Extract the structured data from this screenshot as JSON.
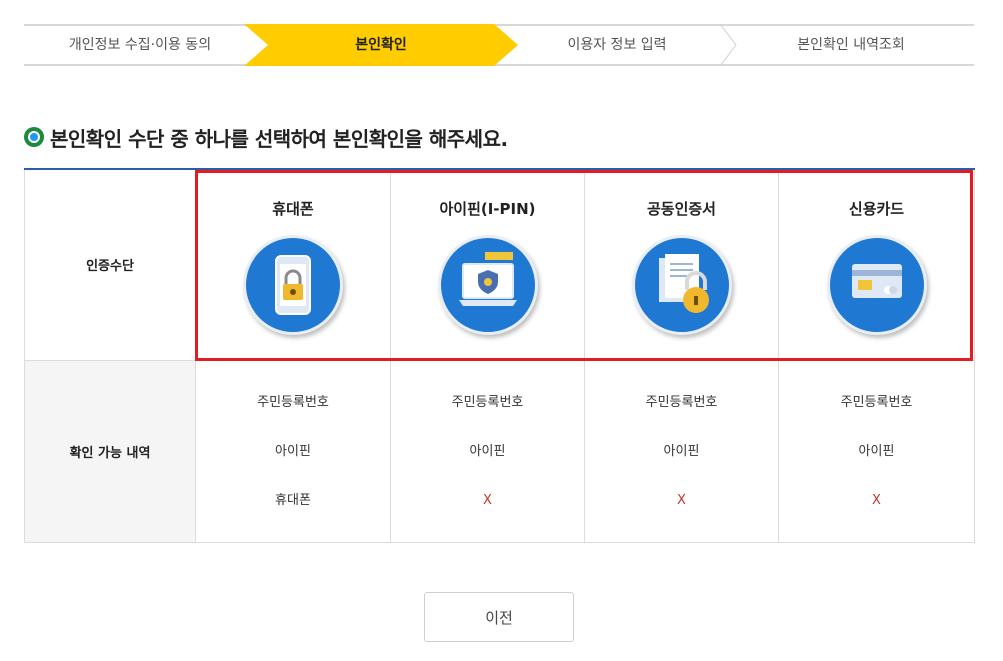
{
  "steps": [
    {
      "label": "개인정보 수집·이용 동의",
      "active": false
    },
    {
      "label": "본인확인",
      "active": true
    },
    {
      "label": "이용자 정보 입력",
      "active": false
    },
    {
      "label": "본인확인 내역조회",
      "active": false
    }
  ],
  "heading": "본인확인 수단 중 하나를 선택하여 본인확인을 해주세요.",
  "table": {
    "method_row_label": "인증수단",
    "avail_row_label": "확인 가능 내역",
    "methods": [
      {
        "name": "휴대폰",
        "icon": "phone-lock-icon"
      },
      {
        "name": "아이핀(I-PIN)",
        "icon": "ipin-laptop-icon"
      },
      {
        "name": "공동인증서",
        "icon": "certificate-lock-icon"
      },
      {
        "name": "신용카드",
        "icon": "credit-card-icon"
      }
    ],
    "availability": [
      [
        "주민등록번호",
        "아이핀",
        "휴대폰"
      ],
      [
        "주민등록번호",
        "아이핀",
        "X"
      ],
      [
        "주민등록번호",
        "아이핀",
        "X"
      ],
      [
        "주민등록번호",
        "아이핀",
        "X"
      ]
    ]
  },
  "buttons": {
    "prev": "이전"
  },
  "colors": {
    "active_step": "#ffcc00",
    "table_top_border": "#2b5ea9",
    "icon_circle": "#1f78d1",
    "highlight_border": "#e31b23",
    "unavailable": "#c0392b"
  }
}
